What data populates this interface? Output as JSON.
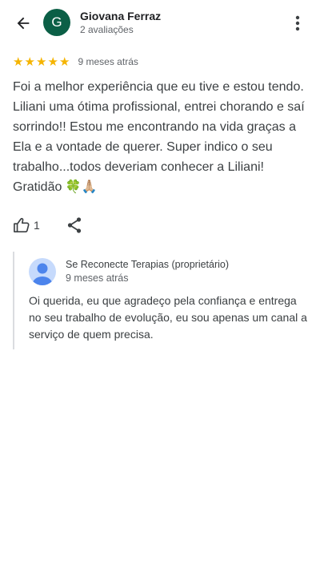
{
  "header": {
    "back_icon": "arrow-left-icon",
    "avatar_letter": "G",
    "avatar_color": "#0b5f46",
    "reviewer_name": "Giovana Ferraz",
    "reviewer_reviews": "2 avaliações",
    "more_icon": "more-vertical-icon"
  },
  "review": {
    "rating": 5,
    "rating_max": 5,
    "star_color": "#f5b400",
    "time": "9 meses atrás",
    "text": "Foi a melhor experiência que eu tive e estou tendo. Liliani uma ótima profissional, entrei chorando e saí sorrindo!! Estou me encontrando na vida graças a Ela e a vontade de querer. Super indico o seu trabalho...todos deveriam conhecer a Liliani! Gratidão 🍀🙏🏼"
  },
  "actions": {
    "like_icon": "thumbs-up-icon",
    "like_count": "1",
    "share_icon": "share-icon"
  },
  "owner_reply": {
    "avatar_icon": "person-avatar-icon",
    "name": "Se Reconecte Terapias (proprietário)",
    "time": "9 meses atrás",
    "text": "Oi querida, eu que agradeço pela confiança e entrega no seu trabalho de evolução, eu sou apenas um canal a serviço de quem precisa."
  }
}
